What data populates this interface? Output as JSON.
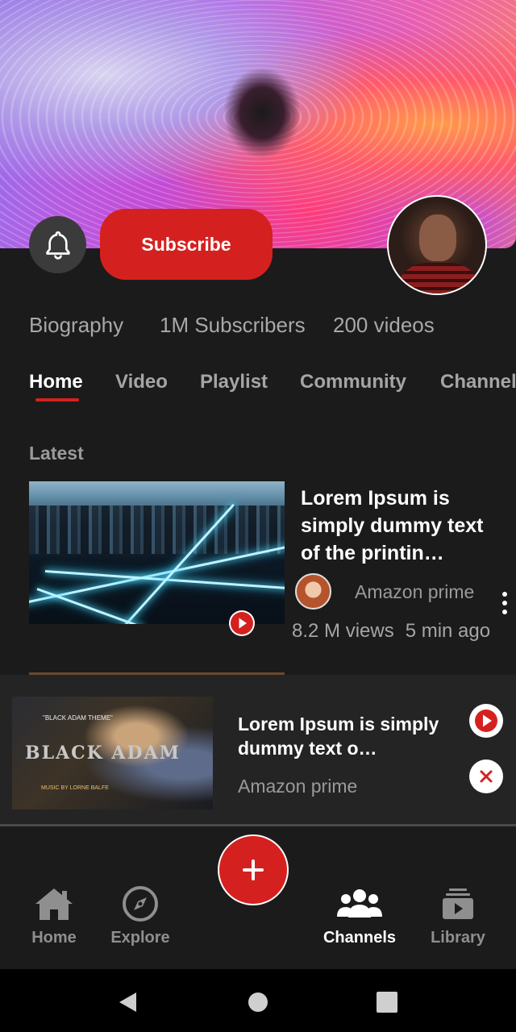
{
  "header": {
    "subscribe_label": "Subscribe"
  },
  "stats": {
    "biography": "Biography",
    "subscribers": "1M Subscribers",
    "videos": "200 videos"
  },
  "tabs": [
    {
      "label": "Home",
      "active": true
    },
    {
      "label": "Video",
      "active": false
    },
    {
      "label": "Playlist",
      "active": false
    },
    {
      "label": "Community",
      "active": false
    },
    {
      "label": "Channel",
      "active": false
    }
  ],
  "section_title": "Latest",
  "video": {
    "title": "Lorem Ipsum is simply dummy text of the printin…",
    "channel": "Amazon prime",
    "views": "8.2 M views",
    "age": "5 min ago"
  },
  "mini_player": {
    "title": "Lorem Ipsum is simply dummy text o…",
    "channel": "Amazon prime",
    "thumb_logo": "BLACK ADAM",
    "thumb_caption": "\"BLACK ADAM THEME\"",
    "thumb_credit": "MUSIC BY LORNE BALFE"
  },
  "bottom_nav": {
    "items": [
      {
        "label": "Home",
        "icon": "home-icon",
        "active": false
      },
      {
        "label": "Explore",
        "icon": "compass-icon",
        "active": false
      },
      {
        "label": "Channels",
        "icon": "people-icon",
        "active": true
      },
      {
        "label": "Library",
        "icon": "library-icon",
        "active": false
      }
    ],
    "fab_icon": "plus-icon"
  },
  "colors": {
    "accent": "#d4211f",
    "background": "#1b1b1b",
    "mini_player_bg": "#242424",
    "muted_text": "#a5a5a5"
  }
}
